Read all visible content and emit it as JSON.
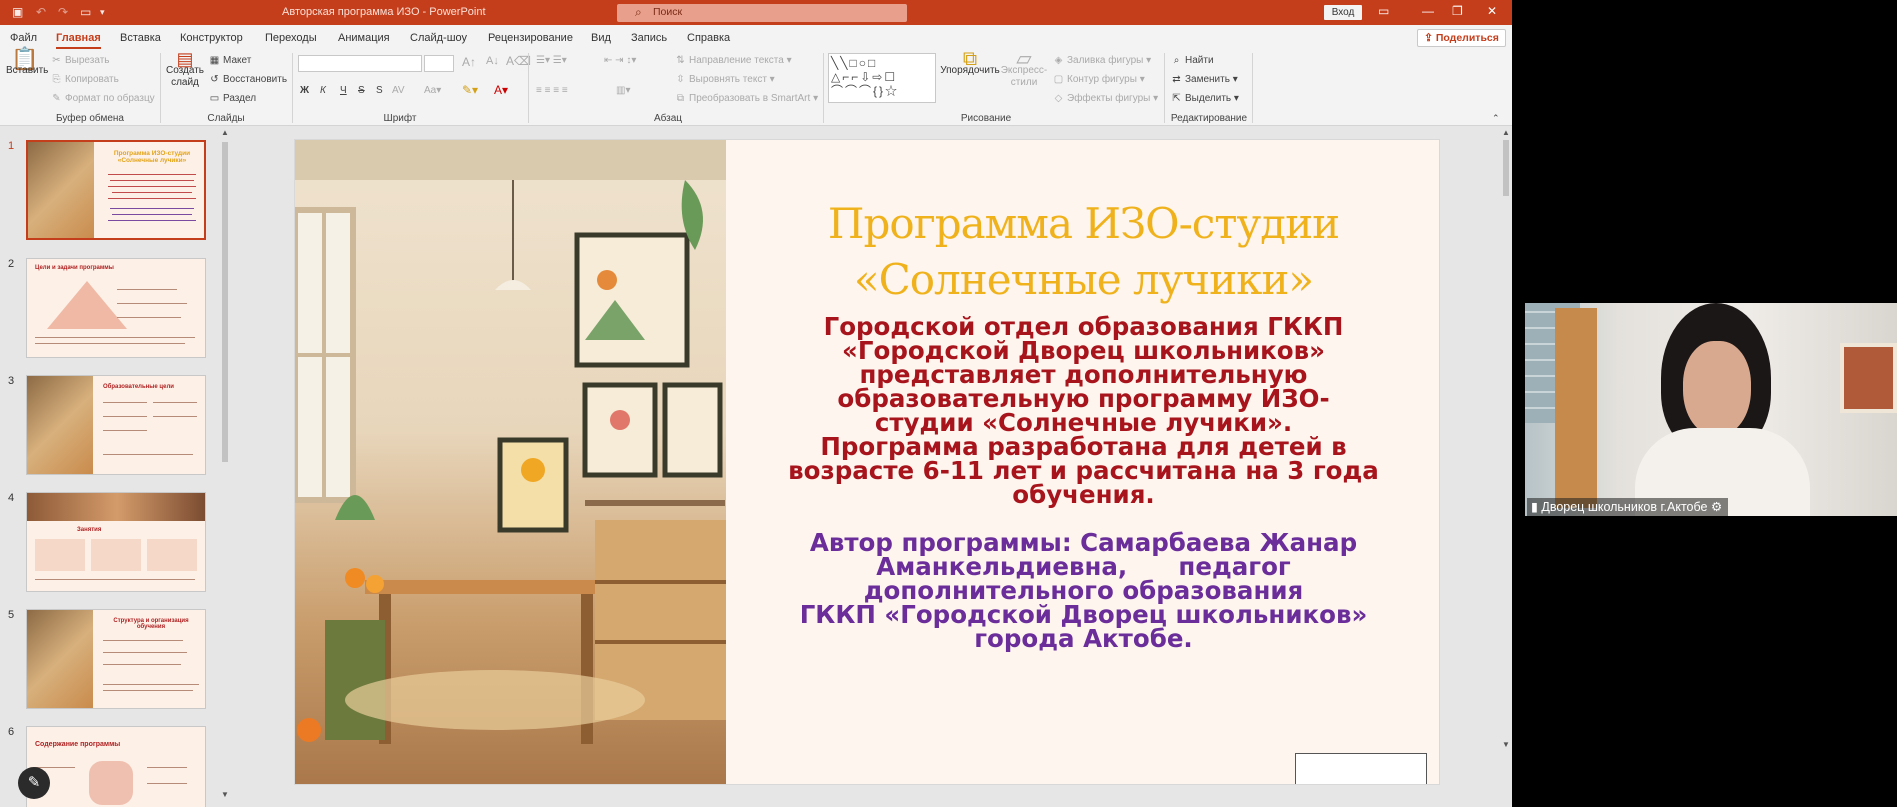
{
  "window": {
    "doc_title": "Авторская программа ИЗО  -  PowerPoint",
    "search_placeholder": "Поиск",
    "signin_label": "Вход"
  },
  "menu": {
    "tabs": [
      "Файл",
      "Главная",
      "Вставка",
      "Конструктор",
      "Переходы",
      "Анимация",
      "Слайд-шоу",
      "Рецензирование",
      "Вид",
      "Запись",
      "Справка"
    ],
    "active": "Главная",
    "share_label": "Поделиться"
  },
  "ribbon": {
    "clipboard": {
      "paste": "Вставить",
      "cut": "Вырезать",
      "copy": "Копировать",
      "format_painter": "Формат по образцу",
      "group": "Буфер обмена"
    },
    "slides": {
      "new_slide": "Создать слайд",
      "layout": "Макет",
      "reset": "Восстановить",
      "section": "Раздел",
      "group": "Слайды"
    },
    "font": {
      "bold": "Ж",
      "italic": "К",
      "underline": "Ч",
      "strike": "S",
      "group": "Шрифт"
    },
    "paragraph": {
      "direction": "Направление текста",
      "align_text": "Выровнять текст",
      "smartart": "Преобразовать в SmartArt",
      "group": "Абзац"
    },
    "drawing": {
      "arrange": "Упорядочить",
      "quick_styles": "Экспресс-стили",
      "fill": "Заливка фигуры",
      "outline": "Контур фигуры",
      "effects": "Эффекты фигуры",
      "group": "Рисование"
    },
    "editing": {
      "find": "Найти",
      "replace": "Заменить",
      "select": "Выделить",
      "group": "Редактирование"
    }
  },
  "thumbnails": [
    {
      "num": "1",
      "title": "Программа ИЗО-студии «Солнечные лучики»"
    },
    {
      "num": "2",
      "title": "Цели и задачи программы"
    },
    {
      "num": "3",
      "title": "Образовательные цели"
    },
    {
      "num": "4",
      "title": "Занятия"
    },
    {
      "num": "5",
      "title": "Структура и организация обучения"
    },
    {
      "num": "6",
      "title": "Содержание программы"
    }
  ],
  "slide": {
    "title_line1": "Программа ИЗО-студии",
    "title_line2": "«Солнечные лучики»",
    "body_red": [
      "Городской отдел образования ГККП",
      "«Городской Дворец школьников»",
      "представляет дополнительную",
      "образовательную программу ИЗО-",
      "студии «Солнечные лучики».",
      "Программа разработана для детей в",
      "возрасте 6-11 лет и рассчитана на 3 года",
      "обучения."
    ],
    "body_purple": [
      "Автор программы: Самарбаева Жанар",
      "Аманкельдиевна,      педагог",
      "дополнительного образования",
      "ГККП «Городской Дворец школьников»",
      "города Актобе."
    ]
  },
  "video": {
    "participant_name": "Дворец школьников г.Актобе"
  },
  "colors": {
    "accent": "#c43e1c",
    "title_gold": "#f0b21c",
    "text_red": "#a8141c",
    "text_purple": "#6a2d9a"
  }
}
